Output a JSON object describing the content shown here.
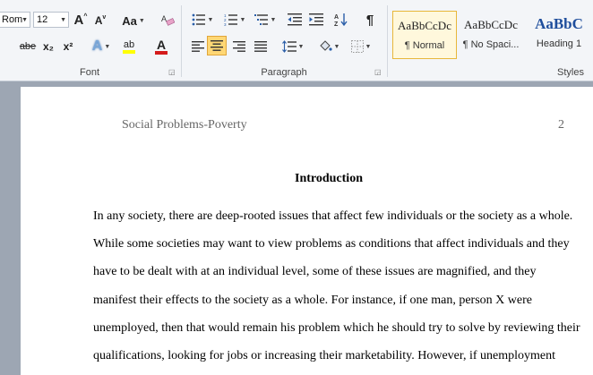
{
  "ribbon": {
    "font": {
      "label": "Font",
      "font_name": "Rom",
      "font_size": "12",
      "grow_label": "A",
      "shrink_label": "A",
      "change_case_label": "Aa",
      "strike_label": "abe",
      "subscript_label": "x₂",
      "superscript_label": "x²",
      "text_effects_label": "A",
      "highlight_label": "ab",
      "font_color_label": "A"
    },
    "paragraph": {
      "label": "Paragraph"
    },
    "styles": {
      "label": "Styles",
      "items": [
        {
          "sample": "AaBbCcDc",
          "name": "¶ Normal",
          "selected": true
        },
        {
          "sample": "AaBbCcDc",
          "name": "¶ No Spaci...",
          "selected": false
        },
        {
          "sample": "AaBbC",
          "name": "Heading 1",
          "selected": false
        }
      ]
    },
    "colors": {
      "highlight": "#ffff00",
      "font_color": "#d41b1b",
      "heading_blue": "#1f4e9c",
      "selected_style": "#e8b73a"
    }
  },
  "document": {
    "header_left": "Social Problems-Poverty",
    "page_number": "2",
    "heading": "Introduction",
    "lines": [
      " In any society, there are deep-rooted issues that affect few individuals or the society as a whole.",
      "While some societies may want to view problems as conditions that affect individuals and they",
      "have to be dealt with at an individual level, some of these issues are magnified, and they",
      "manifest their effects to the society as a whole. For instance, if one man, person X were",
      "unemployed, then that would remain his problem which he should try to solve by reviewing their",
      "qualifications, looking for jobs or increasing their marketability. However, if unemployment"
    ]
  }
}
